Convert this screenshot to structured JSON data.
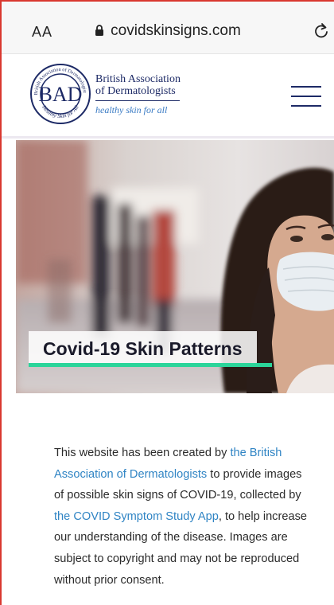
{
  "browser": {
    "text_size_label": "AA",
    "url": "covidskinsigns.com",
    "icons": {
      "lock": "lock-icon",
      "reload": "reload-icon"
    }
  },
  "site": {
    "logo_text": "BAD",
    "logo_ring_text": "British Association of Dermatologists",
    "logo_ring_bottom": "Healthy Skin for All",
    "org_line1": "British Association",
    "org_line2": "of Dermatologists",
    "tagline": "healthy skin for all",
    "menu_icon": "hamburger-menu-icon"
  },
  "hero": {
    "title": "Covid-19 Skin Patterns"
  },
  "intro": {
    "t1": "This website has been created by ",
    "link1": "the British Association of Dermatologists",
    "t2": " to provide images of possible skin signs of COVID-19, collected by ",
    "link2": "the COVID Symptom Study App",
    "t3": ", to help increase our understanding of the disease. Images are subject to copyright and may not be reproduced without prior consent."
  },
  "colors": {
    "brand_navy": "#1d2a66",
    "link_blue": "#2f84c4",
    "accent_green": "#2bd59a",
    "frame_red": "#d9382f"
  }
}
